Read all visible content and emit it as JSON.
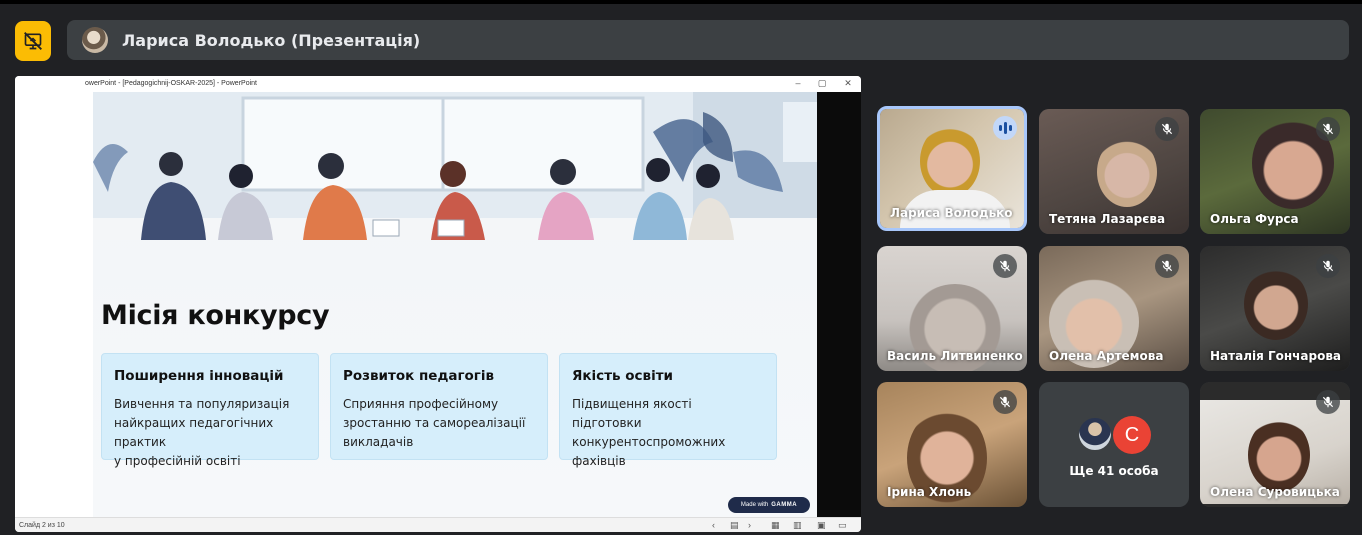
{
  "meeting": {
    "presenter_title": "Лариса Володько (Презентація)"
  },
  "ppt": {
    "window_title": "owerPoint - [Pedagogichnij-OSKAR-2025] - PowerPoint",
    "status_left": "Слайд 2 из 10",
    "slide": {
      "title": "Місія конкурсу",
      "cards": [
        {
          "title": "Поширення інновацій",
          "text": [
            "Вивчення та популяризація",
            "найкращих педагогічних практик",
            "у професійній освіті"
          ]
        },
        {
          "title": "Розвиток педагогів",
          "text": [
            "Сприяння професійному",
            "зростанню та самореалізації",
            "викладачів"
          ]
        },
        {
          "title": "Якість освіти",
          "text": [
            "Підвищення якості підготовки",
            "конкурентоспроможних фахівців"
          ]
        }
      ],
      "badge_prefix": "Made with",
      "badge_brand": "GAMMA"
    }
  },
  "participants": [
    {
      "name": "Лариса Володько",
      "speaking": true
    },
    {
      "name": "Тетяна Лазарєва",
      "muted": true
    },
    {
      "name": "Ольга Фурса",
      "muted": true
    },
    {
      "name": "Василь Литвиненко",
      "muted": true
    },
    {
      "name": "Олена Артемова",
      "muted": true
    },
    {
      "name": "Наталія Гончарова",
      "muted": true
    },
    {
      "name": "Ірина Хлонь",
      "muted": true
    },
    {
      "name": "Олена Суровицька",
      "muted": true
    }
  ],
  "others": {
    "label": "Ще 41 особа",
    "avatar_letter": "С"
  },
  "colors": {
    "background": "#202124",
    "present_icon": "#fbbc04",
    "active_border": "#a8c7fa",
    "card_bg": "#d6eefb",
    "other_avatar": "#ea4335"
  }
}
